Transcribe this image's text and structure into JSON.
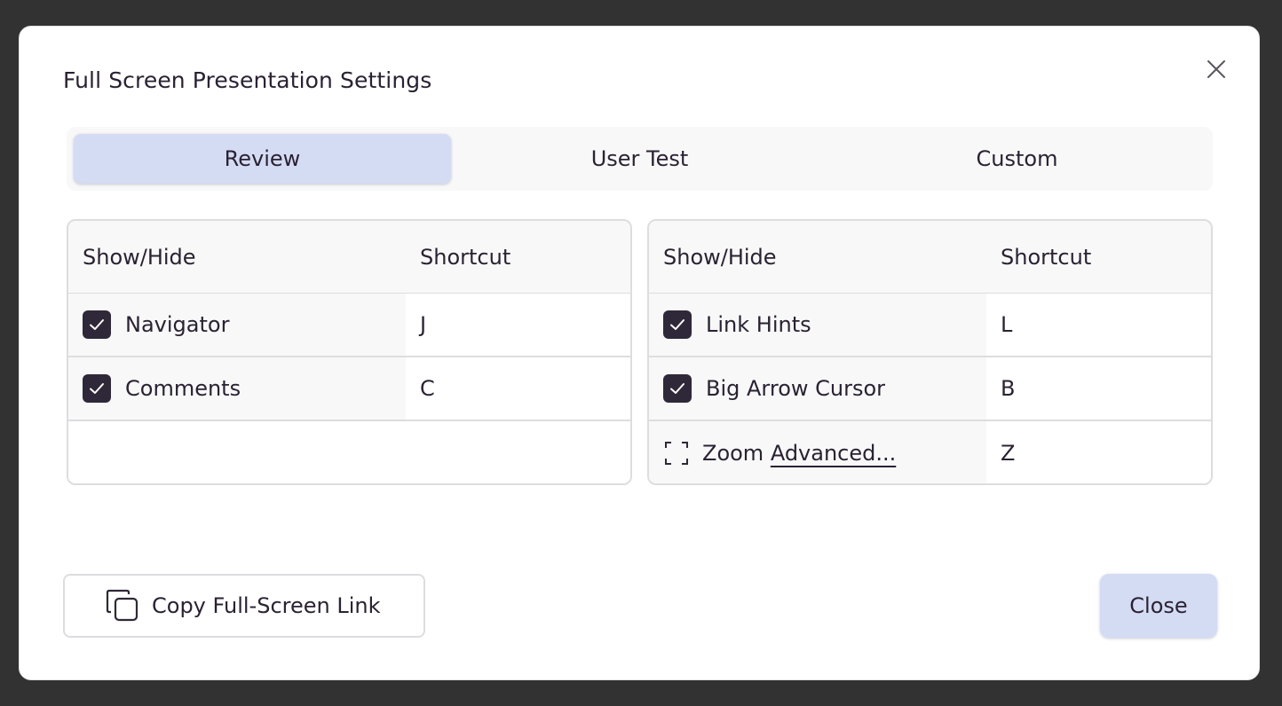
{
  "dialog": {
    "title": "Full Screen Presentation Settings"
  },
  "tabs": [
    {
      "label": "Review",
      "active": true
    },
    {
      "label": "User Test",
      "active": false
    },
    {
      "label": "Custom",
      "active": false
    }
  ],
  "left_table": {
    "headers": {
      "show_hide": "Show/Hide",
      "shortcut": "Shortcut"
    },
    "rows": [
      {
        "label": "Navigator",
        "shortcut": "J",
        "checked": true
      },
      {
        "label": "Comments",
        "shortcut": "C",
        "checked": true
      }
    ]
  },
  "right_table": {
    "headers": {
      "show_hide": "Show/Hide",
      "shortcut": "Shortcut"
    },
    "rows": [
      {
        "label": "Link Hints",
        "shortcut": "L",
        "checked": true
      },
      {
        "label": "Big Arrow Cursor",
        "shortcut": "B",
        "checked": true
      },
      {
        "label_prefix": "Zoom",
        "label_link": "Advanced...",
        "shortcut": "Z",
        "checked": false
      }
    ]
  },
  "footer": {
    "copy_label": "Copy Full-Screen Link",
    "close_label": "Close"
  },
  "icons": {
    "close": "close-icon",
    "check": "check-icon",
    "copy": "copy-icon",
    "dashed_box": "dashed-checkbox-icon"
  },
  "colors": {
    "accent": "#d4dcf4",
    "checkbox": "#2f2838",
    "text": "#2a2233"
  }
}
